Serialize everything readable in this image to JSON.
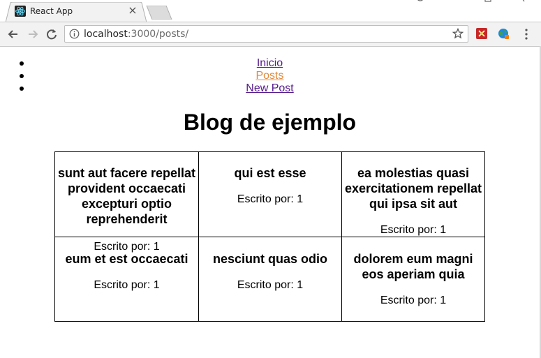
{
  "browser": {
    "tab_title": "React App",
    "tab_close": "×",
    "url_host": "localhost",
    "url_path": ":3000/posts/"
  },
  "nav": {
    "items": [
      {
        "label": "Inicio",
        "color": "#551a8b"
      },
      {
        "label": "Posts",
        "color": "#e08a3c"
      },
      {
        "label": "New Post",
        "color": "#551a8b"
      }
    ]
  },
  "page": {
    "title": "Blog de ejemplo"
  },
  "posts": [
    {
      "title": "sunt aut facere repellat provident occaecati excepturi optio reprehenderit",
      "author": "Escrito por: 1"
    },
    {
      "title": "qui est esse",
      "author": "Escrito por: 1"
    },
    {
      "title": "ea molestias quasi exercitationem repellat qui ipsa sit aut",
      "author": "Escrito por: 1"
    },
    {
      "title": "eum et est occaecati",
      "author": "Escrito por: 1"
    },
    {
      "title": "nesciunt quas odio",
      "author": "Escrito por: 1"
    },
    {
      "title": "dolorem eum magni eos aperiam quia",
      "author": "Escrito por: 1"
    }
  ],
  "colors": {
    "link_visited": "#551a8b",
    "link_active": "#e08a3c",
    "chrome_bg": "#f2f2f2"
  }
}
